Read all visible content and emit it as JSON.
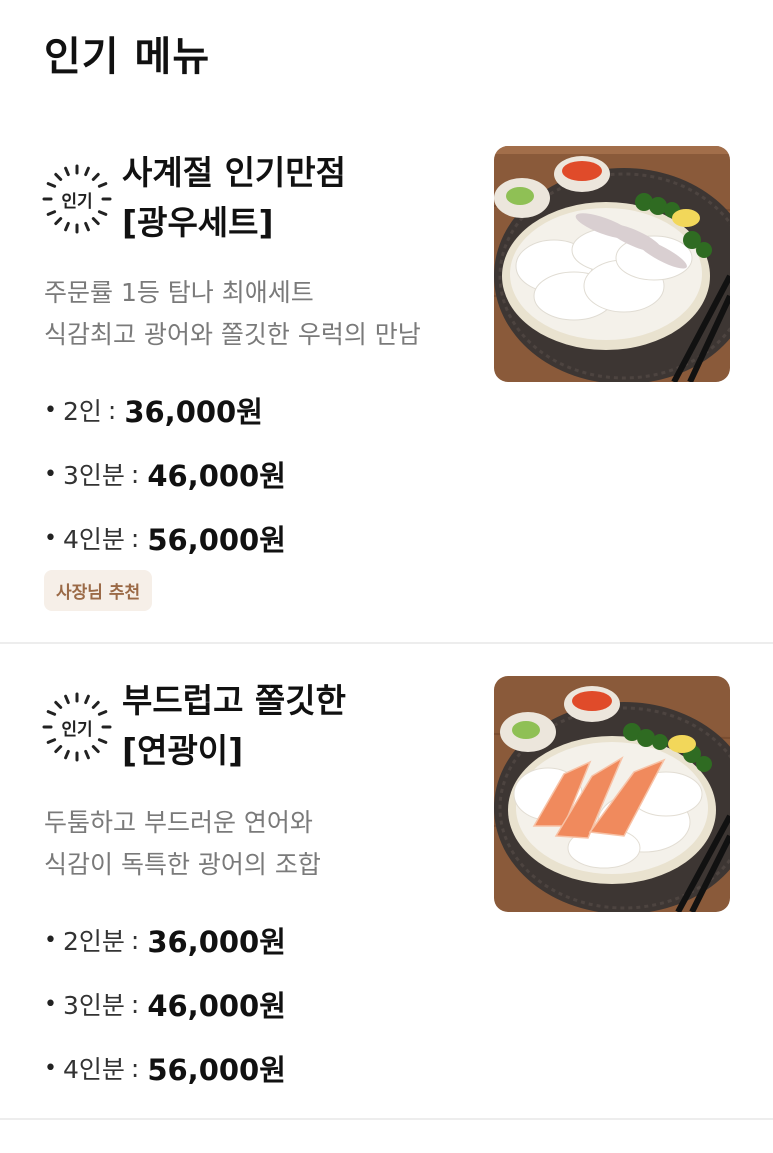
{
  "section": {
    "title": "인기 메뉴"
  },
  "menus": [
    {
      "badge": "인기",
      "name_line1": "사계절 인기만점",
      "name_line2": "[광우세트]",
      "desc_line1": "주문률 1등 탐나 최애세트",
      "desc_line2": "식감최고 광어와 쫄깃한 우럭의 만남",
      "prices": [
        {
          "portion": "2인",
          "amount": "36,000원"
        },
        {
          "portion": "3인분",
          "amount": "46,000원"
        },
        {
          "portion": "4인분",
          "amount": "56,000원"
        }
      ],
      "tag": "사장님 추천",
      "image_icon": "sashimi-platter-photo"
    },
    {
      "badge": "인기",
      "name_line1": "부드럽고 쫄깃한",
      "name_line2": "[연광이]",
      "desc_line1": "두툼하고 부드러운 연어와",
      "desc_line2": "식감이 독특한 광어의 조합",
      "prices": [
        {
          "portion": "2인분",
          "amount": "36,000원"
        },
        {
          "portion": "3인분",
          "amount": "46,000원"
        },
        {
          "portion": "4인분",
          "amount": "56,000원"
        }
      ],
      "image_icon": "salmon-flatfish-platter-photo"
    }
  ],
  "colors": {
    "tag_bg": "#f6efe8",
    "tag_text": "#9b6a47",
    "desc_text": "#7a7a7a",
    "divider": "#ededed"
  }
}
